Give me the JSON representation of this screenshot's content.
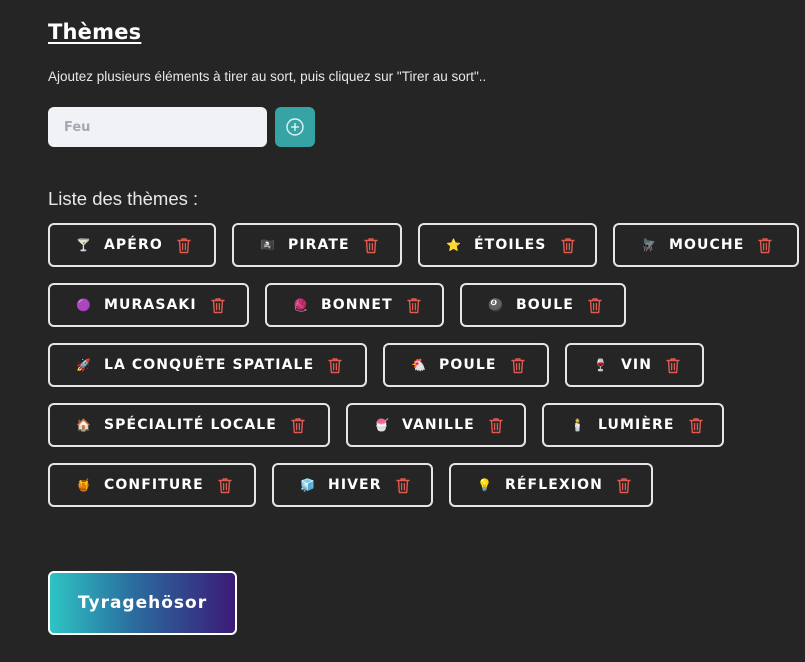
{
  "header": {
    "title": "Thèmes",
    "instructions": "Ajoutez plusieurs éléments à tirer au sort, puis cliquez sur \"Tirer au sort\".."
  },
  "input": {
    "placeholder": "Feu",
    "value": "",
    "add_icon": "plus-circle-icon"
  },
  "list": {
    "label": "Liste des thèmes :",
    "delete_icon": "trash-icon",
    "delete_color": "#e05a52",
    "items": [
      {
        "emoji": "🍸",
        "label": "APÉRO"
      },
      {
        "emoji": "🏴‍☠️",
        "label": "PIRATE"
      },
      {
        "emoji": "⭐",
        "label": "ÉTOILES"
      },
      {
        "emoji": "🪰",
        "label": "MOUCHE"
      },
      {
        "emoji": "🟣",
        "label": "MURASAKI"
      },
      {
        "emoji": "🧶",
        "label": "BONNET"
      },
      {
        "emoji": "🎱",
        "label": "BOULE"
      },
      {
        "emoji": "🚀",
        "label": "LA CONQUÊTE SPATIALE"
      },
      {
        "emoji": "🐔",
        "label": "POULE"
      },
      {
        "emoji": "🍷",
        "label": "VIN"
      },
      {
        "emoji": "🏠",
        "label": "SPÉCIALITÉ LOCALE"
      },
      {
        "emoji": "🍧",
        "label": "VANILLE"
      },
      {
        "emoji": "🕯️",
        "label": "LUMIÈRE"
      },
      {
        "emoji": "🍯",
        "label": "CONFITURE"
      },
      {
        "emoji": "🧊",
        "label": "HIVER"
      },
      {
        "emoji": "💡",
        "label": "RÉFLEXION"
      }
    ]
  },
  "actions": {
    "draw_label": "Tyragehösor"
  },
  "colors": {
    "background": "#252525",
    "accent": "#36a3a5",
    "tag_border": "#e6e6e6",
    "draw_gradient_start": "#2ec4c4",
    "draw_gradient_end": "#3c1a78"
  }
}
